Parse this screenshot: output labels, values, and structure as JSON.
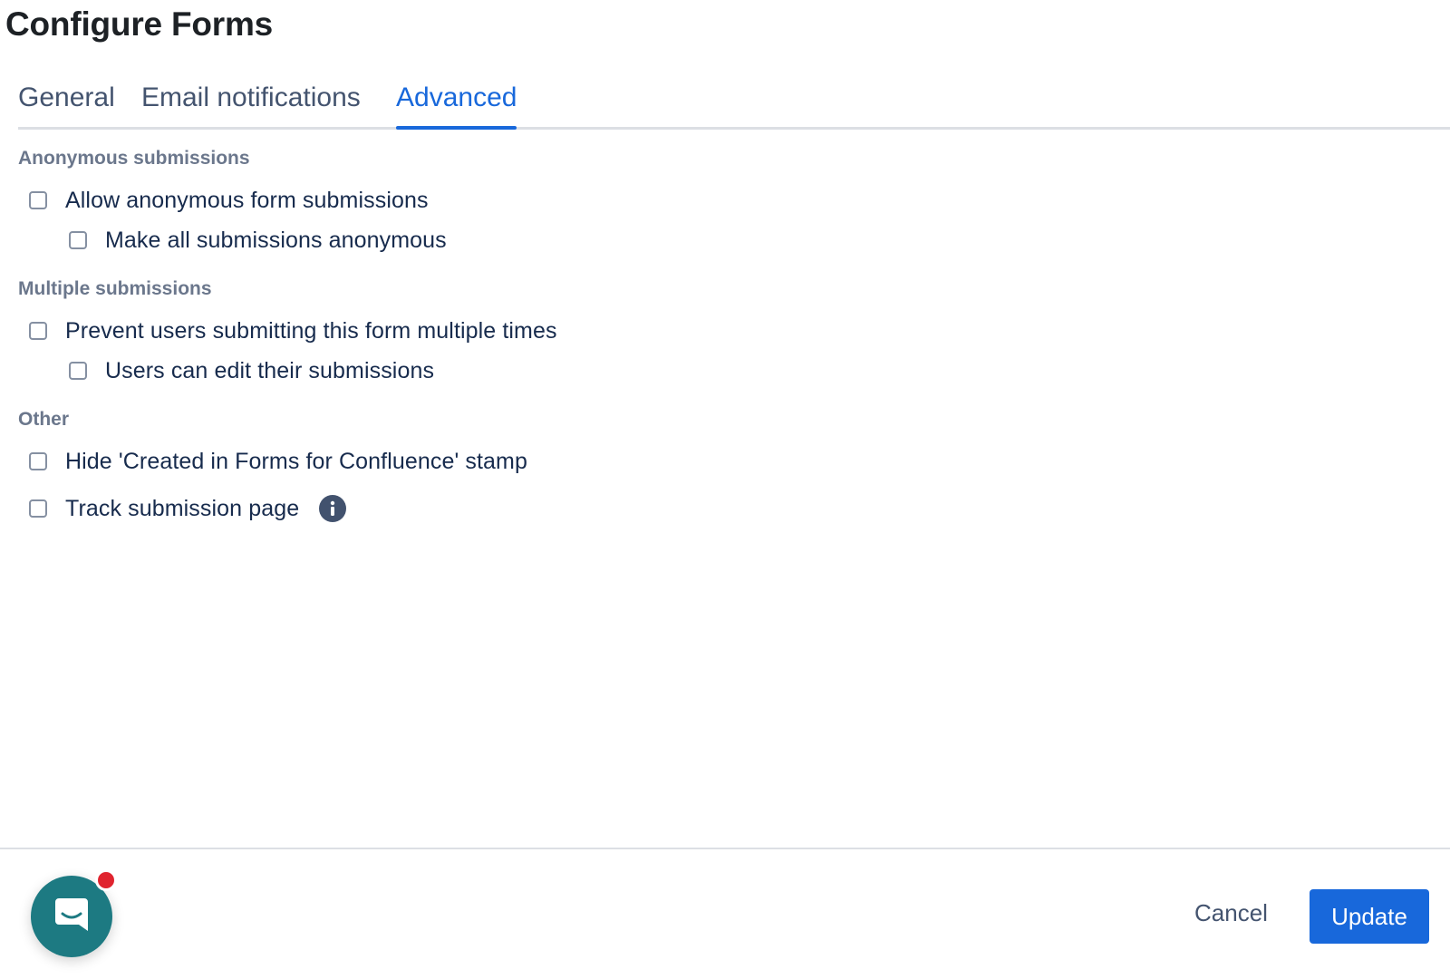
{
  "dialog": {
    "title": "Configure Forms"
  },
  "tabs": [
    {
      "label": "General",
      "active": false
    },
    {
      "label": "Email notifications",
      "active": false
    },
    {
      "label": "Advanced",
      "active": true
    }
  ],
  "sections": {
    "anonymous": {
      "heading": "Anonymous submissions",
      "options": [
        {
          "label": "Allow anonymous form submissions",
          "checked": false
        },
        {
          "label": "Make all submissions anonymous",
          "checked": false
        }
      ]
    },
    "multiple": {
      "heading": "Multiple submissions",
      "options": [
        {
          "label": "Prevent users submitting this form multiple times",
          "checked": false
        },
        {
          "label": "Users can edit their submissions",
          "checked": false
        }
      ]
    },
    "other": {
      "heading": "Other",
      "options": [
        {
          "label": "Hide 'Created in Forms for Confluence' stamp",
          "checked": false
        },
        {
          "label": "Track submission page",
          "checked": false,
          "icon": "info-icon"
        }
      ]
    }
  },
  "footer": {
    "cancel_label": "Cancel",
    "update_label": "Update"
  },
  "chat_widget": {
    "icon": "chat-icon",
    "has_notification": true
  },
  "colors": {
    "accent": "#1868db",
    "chat_bubble": "#1d7a82",
    "notification_dot": "#e0242f"
  }
}
